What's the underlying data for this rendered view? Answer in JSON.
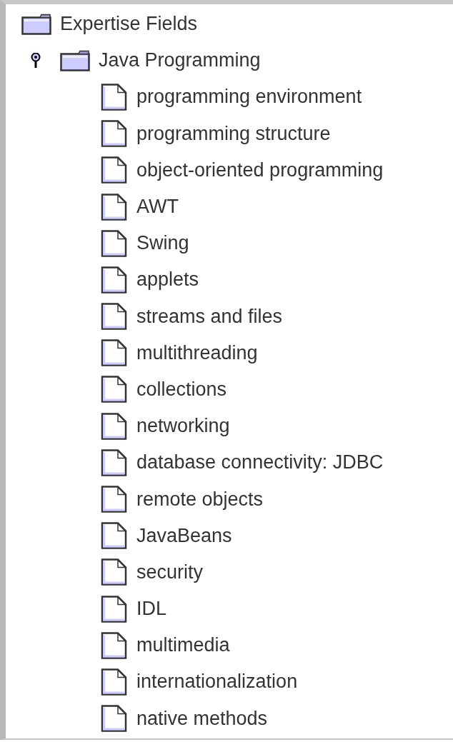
{
  "tree": {
    "label": "Expertise Fields",
    "kind": "folder",
    "children": [
      {
        "label": "Java Programming",
        "kind": "folder",
        "expanded": true,
        "children": [
          {
            "label": "programming environment",
            "kind": "file"
          },
          {
            "label": "programming structure",
            "kind": "file"
          },
          {
            "label": "object-oriented programming",
            "kind": "file"
          },
          {
            "label": "AWT",
            "kind": "file"
          },
          {
            "label": "Swing",
            "kind": "file"
          },
          {
            "label": "applets",
            "kind": "file"
          },
          {
            "label": "streams and files",
            "kind": "file"
          },
          {
            "label": "multithreading",
            "kind": "file"
          },
          {
            "label": "collections",
            "kind": "file"
          },
          {
            "label": "networking",
            "kind": "file"
          },
          {
            "label": "database connectivity: JDBC",
            "kind": "file"
          },
          {
            "label": "remote objects",
            "kind": "file"
          },
          {
            "label": "JavaBeans",
            "kind": "file"
          },
          {
            "label": "security",
            "kind": "file"
          },
          {
            "label": "IDL",
            "kind": "file"
          },
          {
            "label": "multimedia",
            "kind": "file"
          },
          {
            "label": "internationalization",
            "kind": "file"
          },
          {
            "label": "native methods",
            "kind": "file"
          }
        ]
      }
    ]
  }
}
